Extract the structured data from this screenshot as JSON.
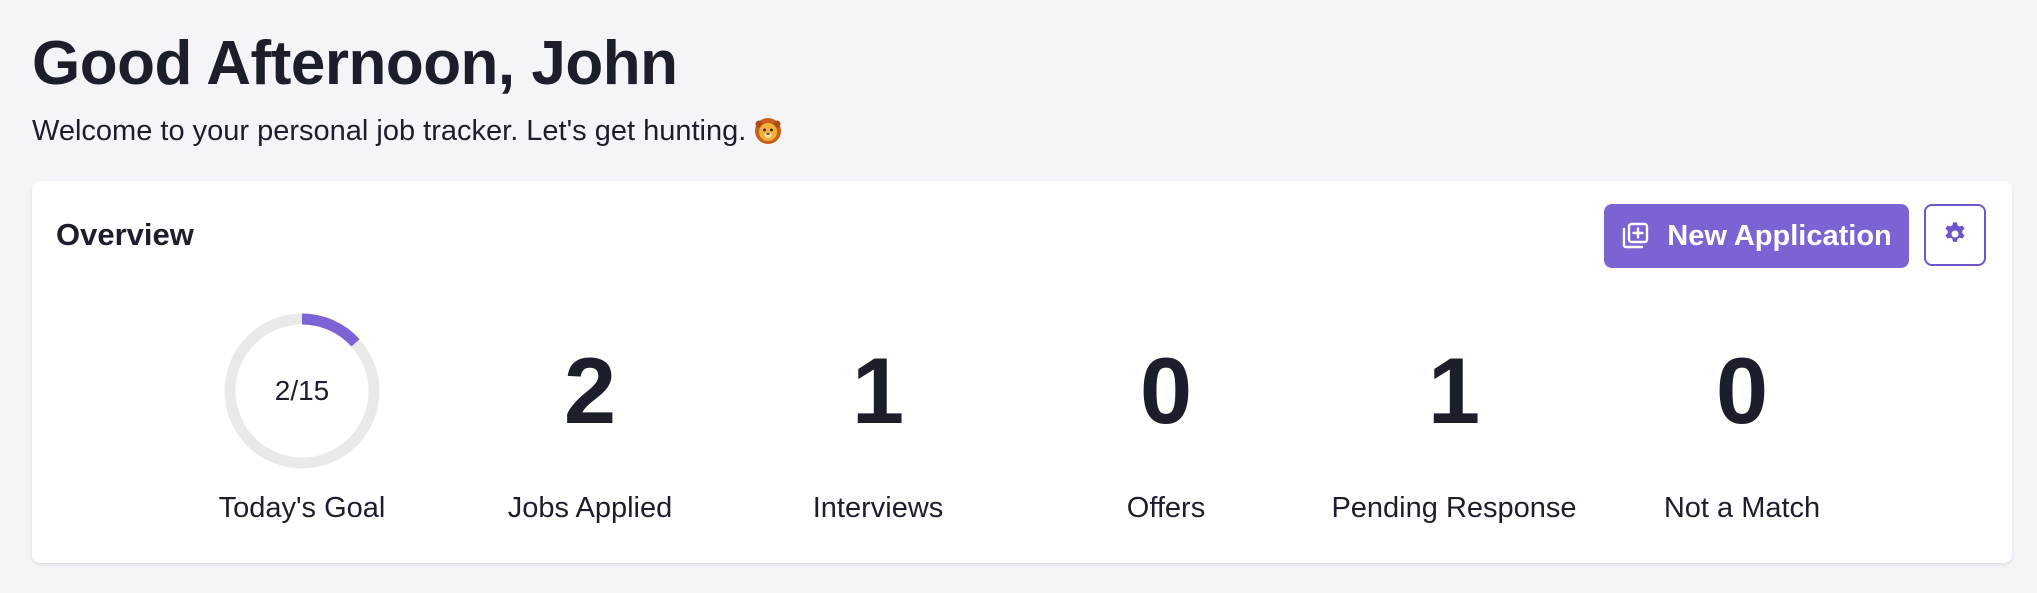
{
  "header": {
    "greeting": "Good Afternoon, John",
    "subtitle": "Welcome to your personal job tracker. Let's get hunting.",
    "subtitle_emoji_icon": "lion-face-icon"
  },
  "overview": {
    "title": "Overview",
    "new_application_label": "New Application",
    "new_application_icon": "add-to-collection-icon",
    "settings_icon": "gear-icon",
    "goal": {
      "applied": 2,
      "target": 15,
      "text": "2/15",
      "label": "Today's Goal"
    },
    "stats": [
      {
        "value": "2",
        "label": "Jobs Applied"
      },
      {
        "value": "1",
        "label": "Interviews"
      },
      {
        "value": "0",
        "label": "Offers"
      },
      {
        "value": "1",
        "label": "Pending Response"
      },
      {
        "value": "0",
        "label": "Not a Match"
      }
    ]
  },
  "colors": {
    "accent": "#7c62d3",
    "ring_track": "#e9e9e9",
    "background": "#f4f4f9",
    "text": "#1c1e2c"
  }
}
